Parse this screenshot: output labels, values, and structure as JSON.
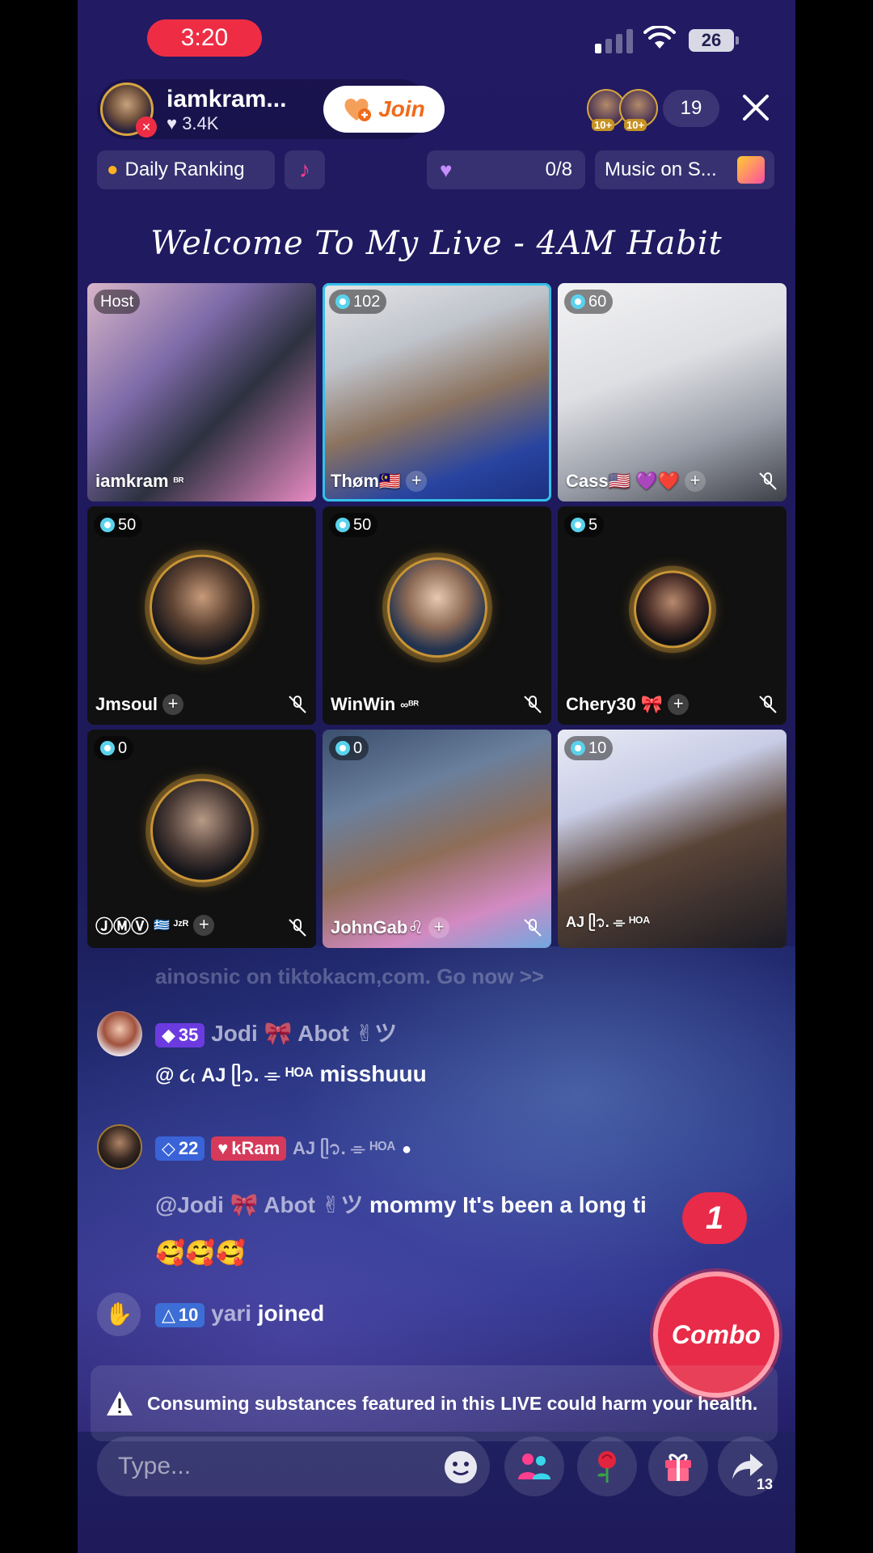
{
  "status": {
    "time": "3:20",
    "battery": "26"
  },
  "host": {
    "name": "iamkram...",
    "likes": "3.4K",
    "join_label": "Join"
  },
  "viewers": {
    "badge_1": "10+",
    "badge_2": "10+",
    "count": "19"
  },
  "chips": {
    "ranking": "Daily Ranking",
    "hearts": "0/8",
    "music": "Music on S..."
  },
  "live_title": "Welcome To My Live - 4AM Habit",
  "tiles": [
    {
      "badge": "Host",
      "name": "iamkram",
      "suffix": "ᴮᴿ"
    },
    {
      "badge": "102",
      "name": "Thøm🇲🇾"
    },
    {
      "badge": "60",
      "name": "Cass🇺🇸 💜❤️"
    },
    {
      "badge": "50",
      "name": "Jmsoul"
    },
    {
      "badge": "50",
      "name": "WinWin",
      "suffix": "∞ᴮᴿ"
    },
    {
      "badge": "5",
      "name": "Chery30",
      "suffix": "🎀"
    },
    {
      "badge": "0",
      "name": "ⒿⓂⓋ",
      "suffix": "🇬🇷 ᴶᶻᴿ"
    },
    {
      "badge": "0",
      "name": "JohnGab♌"
    },
    {
      "badge": "10",
      "name": "AJ ᥫ᭡. ⌯ ᴴᴼᴬ"
    }
  ],
  "chat": {
    "faded_line": "ainosnic on tiktokacm,com. Go now >>",
    "messages": [
      {
        "level": "35",
        "user": "Jodi 🎀 Abot ✌︎ツ",
        "text_mention": "@ ૮₍ AJ ᥫ᭡. ⌯ ᴴᴼᴬ",
        "text": "misshuuu"
      },
      {
        "level": "22",
        "fan_badge": "kRam",
        "user": "AJ ᥫ᭡. ⌯ ᴴᴼᴬ",
        "text_mention": "@Jodi 🎀 Abot ✌︎ツ",
        "text": "mommy It's been a long ti",
        "emojis": "🥰🥰🥰"
      }
    ],
    "join_event": {
      "level": "10",
      "user": "yari",
      "action": "joined"
    }
  },
  "combo": {
    "count": "1",
    "label": "Combo"
  },
  "warning": "Consuming substances featured in this LIVE could harm your health.",
  "input": {
    "placeholder": "Type..."
  },
  "share_count": "13",
  "colors": {
    "accent": "#e72b48",
    "background": "#221a63",
    "active_tile": "#33c0ea"
  }
}
